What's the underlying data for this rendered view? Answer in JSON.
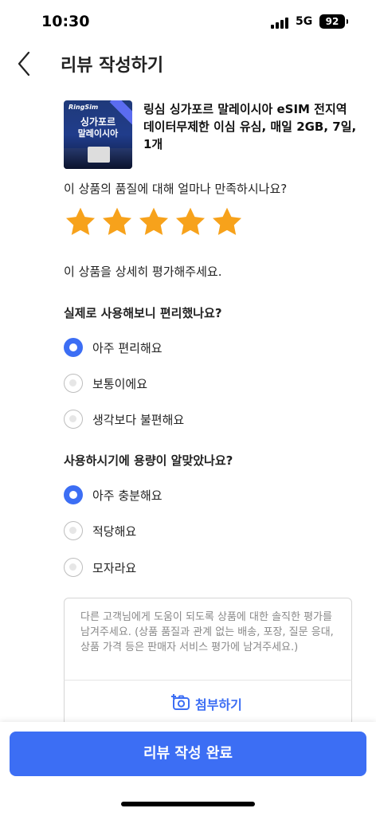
{
  "status_bar": {
    "time": "10:30",
    "network": "5G",
    "battery": "92"
  },
  "header": {
    "title": "리뷰 작성하기"
  },
  "product": {
    "thumb_logo": "RingSim",
    "thumb_line1": "싱가포르",
    "thumb_line2": "말레이시아",
    "title": "링심 싱가포르 말레이시아 eSIM 전지역 데이터무제한 이심 유심, 매일 2GB, 7일, 1개"
  },
  "rating": {
    "question": "이 상품의 품질에 대해 얼마나 만족하시나요?",
    "stars": 5,
    "max_stars": 5,
    "star_color": "#f7a21b"
  },
  "detail_prompt": "이 상품을 상세히 평가해주세요.",
  "q1": {
    "question": "실제로 사용해보니 편리했나요?",
    "options": [
      "아주 편리해요",
      "보통이에요",
      "생각보다 불편해요"
    ],
    "selected": 0
  },
  "q2": {
    "question": "사용하시기에 용량이 알맞았나요?",
    "options": [
      "아주 충분해요",
      "적당해요",
      "모자라요"
    ],
    "selected": 0
  },
  "review": {
    "placeholder": "다른 고객님에게 도움이 되도록 상품에 대한 솔직한 평가를 남겨주세요. (상품 품질과 관계 없는 배송, 포장, 질문 응대, 상품 가격 등은 판매자 서비스 평가에 남겨주세요.)",
    "attach_label": "첨부하기"
  },
  "submit_label": "리뷰 작성 완료",
  "colors": {
    "accent": "#3c6ef4",
    "star": "#f7a21b"
  }
}
